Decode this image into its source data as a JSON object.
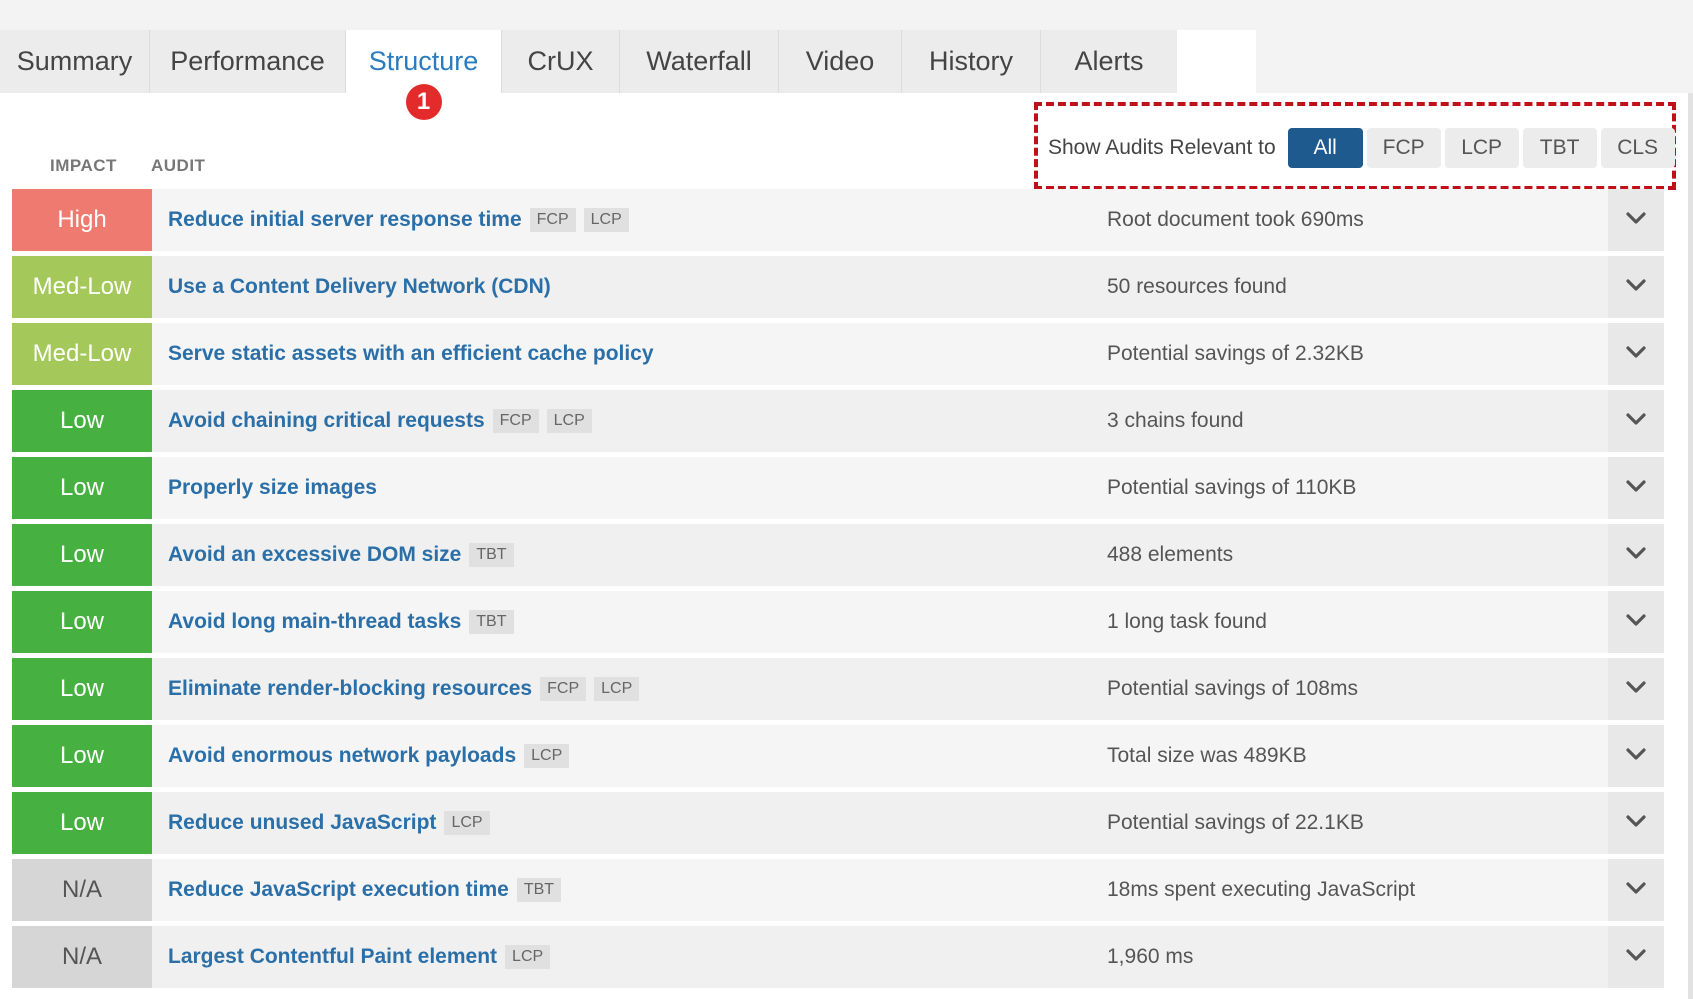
{
  "tabs": [
    {
      "label": "Summary",
      "active": false
    },
    {
      "label": "Performance",
      "active": false
    },
    {
      "label": "Structure",
      "active": true,
      "badge": "1"
    },
    {
      "label": "CrUX",
      "active": false
    },
    {
      "label": "Waterfall",
      "active": false
    },
    {
      "label": "Video",
      "active": false
    },
    {
      "label": "History",
      "active": false
    },
    {
      "label": "Alerts",
      "active": false
    }
  ],
  "filter": {
    "label": "Show Audits Relevant to",
    "options": [
      "All",
      "FCP",
      "LCP",
      "TBT",
      "CLS"
    ],
    "selected": "All"
  },
  "columns": {
    "impact": "IMPACT",
    "audit": "AUDIT"
  },
  "colors": {
    "high": "#ef7b70",
    "med_low": "#a4c95a",
    "low": "#46b140",
    "na": "#d6d6d6",
    "link": "#2a6fa8",
    "active_tab": "#2a7bbf",
    "highlight_box": "#c0111a"
  },
  "audits": [
    {
      "impact": "High",
      "level": "high",
      "title": "Reduce initial server response time",
      "tags": [
        "FCP",
        "LCP"
      ],
      "result": "Root document took 690ms"
    },
    {
      "impact": "Med-Low",
      "level": "medlow",
      "title": "Use a Content Delivery Network (CDN)",
      "tags": [],
      "result": "50 resources found"
    },
    {
      "impact": "Med-Low",
      "level": "medlow",
      "title": "Serve static assets with an efficient cache policy",
      "tags": [],
      "result": "Potential savings of 2.32KB"
    },
    {
      "impact": "Low",
      "level": "low",
      "title": "Avoid chaining critical requests",
      "tags": [
        "FCP",
        "LCP"
      ],
      "result": "3 chains found"
    },
    {
      "impact": "Low",
      "level": "low",
      "title": "Properly size images",
      "tags": [],
      "result": "Potential savings of 110KB"
    },
    {
      "impact": "Low",
      "level": "low",
      "title": "Avoid an excessive DOM size",
      "tags": [
        "TBT"
      ],
      "result": "488 elements"
    },
    {
      "impact": "Low",
      "level": "low",
      "title": "Avoid long main-thread tasks",
      "tags": [
        "TBT"
      ],
      "result": "1 long task found"
    },
    {
      "impact": "Low",
      "level": "low",
      "title": "Eliminate render-blocking resources",
      "tags": [
        "FCP",
        "LCP"
      ],
      "result": "Potential savings of 108ms"
    },
    {
      "impact": "Low",
      "level": "low",
      "title": "Avoid enormous network payloads",
      "tags": [
        "LCP"
      ],
      "result": "Total size was 489KB"
    },
    {
      "impact": "Low",
      "level": "low",
      "title": "Reduce unused JavaScript",
      "tags": [
        "LCP"
      ],
      "result": "Potential savings of 22.1KB"
    },
    {
      "impact": "N/A",
      "level": "na",
      "title": "Reduce JavaScript execution time",
      "tags": [
        "TBT"
      ],
      "result": "18ms spent executing JavaScript"
    },
    {
      "impact": "N/A",
      "level": "na",
      "title": "Largest Contentful Paint element",
      "tags": [
        "LCP"
      ],
      "result": "1,960 ms"
    }
  ],
  "icons": {
    "expand": "chevron-down-icon"
  }
}
